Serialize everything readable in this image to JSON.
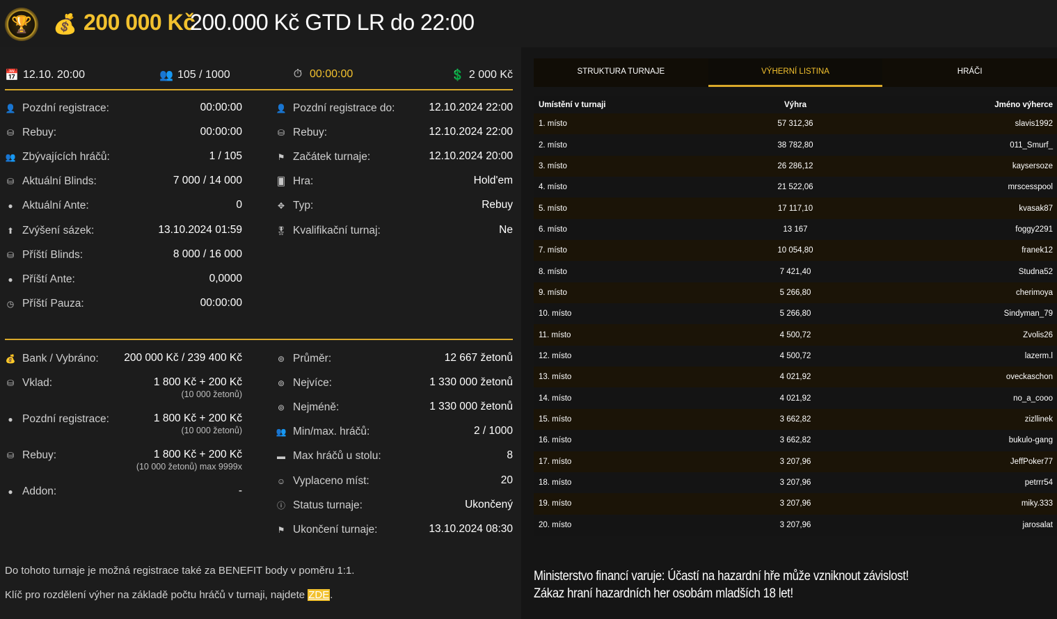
{
  "header": {
    "prize": "200 000 Kč",
    "title": "200.000 Kč GTD LR do 22:00"
  },
  "topbar": {
    "date": "12.10. 20:00",
    "players": "105 / 1000",
    "timer": "00:00:00",
    "buyin": "2 000 Kč"
  },
  "info_left": [
    {
      "icon": "user-icon",
      "label": "Pozdní registrace:",
      "value": "00:00:00"
    },
    {
      "icon": "chips-icon",
      "label": "Rebuy:",
      "value": "00:00:00"
    },
    {
      "icon": "users-icon",
      "label": "Zbývajících hráčů:",
      "value": "1 / 105"
    },
    {
      "icon": "chips-icon",
      "label": "Aktuální Blinds:",
      "value": "7 000 / 14 000"
    },
    {
      "icon": "coin-icon",
      "label": "Aktuální Ante:",
      "value": "0"
    },
    {
      "icon": "arrow-up-icon",
      "label": "Zvýšení sázek:",
      "value": "13.10.2024 01:59"
    },
    {
      "icon": "chips-icon",
      "label": "Příští Blinds:",
      "value": "8 000 / 16 000"
    },
    {
      "icon": "coin-icon",
      "label": "Příští Ante:",
      "value": "0,0000"
    },
    {
      "icon": "clock-icon",
      "label": "Příští Pauza:",
      "value": "00:00:00"
    }
  ],
  "info_right": [
    {
      "icon": "user-icon",
      "label": "Pozdní registrace do:",
      "value": "12.10.2024 22:00"
    },
    {
      "icon": "chips-icon",
      "label": "Rebuy:",
      "value": "12.10.2024 22:00"
    },
    {
      "icon": "flag-icon",
      "label": "Začátek turnaje:",
      "value": "12.10.2024 20:00"
    },
    {
      "icon": "cards-icon",
      "label": "Hra:",
      "value": "Hold'em"
    },
    {
      "icon": "grid-icon",
      "label": "Typ:",
      "value": "Rebuy"
    },
    {
      "icon": "medal-icon",
      "label": "Kvalifikační turnaj:",
      "value": "Ne"
    }
  ],
  "bank_left": [
    {
      "icon": "bag-icon",
      "label": "Bank / Vybráno:",
      "value": "200 000 Kč / 239 400 Kč",
      "sub": ""
    },
    {
      "icon": "chips-icon",
      "label": "Vklad:",
      "value": "1 800 Kč + 200 Kč",
      "sub": "(10 000 žetonů)"
    },
    {
      "icon": "coin-icon",
      "label": "Pozdní registrace:",
      "value": "1 800 Kč + 200 Kč",
      "sub": "(10 000 žetonů)"
    },
    {
      "icon": "chips-icon",
      "label": "Rebuy:",
      "value": "1 800 Kč + 200 Kč",
      "sub": "(10 000 žetonů) max 9999x"
    },
    {
      "icon": "coin-icon",
      "label": "Addon:",
      "value": "-",
      "sub": ""
    }
  ],
  "bank_right": [
    {
      "icon": "chip-icon",
      "label": "Průměr:",
      "value": "12 667 žetonů"
    },
    {
      "icon": "chip-icon",
      "label": "Nejvíce:",
      "value": "1 330 000 žetonů"
    },
    {
      "icon": "chip-icon",
      "label": "Nejméně:",
      "value": "1 330 000 žetonů"
    },
    {
      "icon": "users-icon",
      "label": "Min/max. hráčů:",
      "value": "2 / 1000"
    },
    {
      "icon": "table-icon",
      "label": "Max hráčů u stolu:",
      "value": "8"
    },
    {
      "icon": "payout-icon",
      "label": "Vyplaceno míst:",
      "value": "20"
    },
    {
      "icon": "info-icon",
      "label": "Status turnaje:",
      "value": "Ukončený"
    },
    {
      "icon": "flag-icon",
      "label": "Ukončení turnaje:",
      "value": "13.10.2024 08:30"
    }
  ],
  "notes": {
    "benefit": "Do tohoto turnaje je možná registrace také za BENEFIT body v poměru 1:1.",
    "key_text": "Klíč pro rozdělení výher na základě počtu hráčů v turnaji, najdete ",
    "key_link": "ZDE",
    "key_end": "."
  },
  "tabs": [
    "STRUKTURA TURNAJE",
    "VÝHERNÍ LISTINA",
    "HRÁČI"
  ],
  "table": {
    "headers": [
      "Umístění v turnaji",
      "Výhra",
      "Jméno výherce"
    ],
    "rows": [
      [
        "1. místo",
        "57 312,36",
        "slavis1992"
      ],
      [
        "2. místo",
        "38 782,80",
        "011_Smurf_"
      ],
      [
        "3. místo",
        "26 286,12",
        "kaysersoze"
      ],
      [
        "4. místo",
        "21 522,06",
        "mrscesspool"
      ],
      [
        "5. místo",
        "17 117,10",
        "kvasak87"
      ],
      [
        "6. místo",
        "13 167",
        "foggy2291"
      ],
      [
        "7. místo",
        "10 054,80",
        "franek12"
      ],
      [
        "8. místo",
        "7 421,40",
        "Studna52"
      ],
      [
        "9. místo",
        "5 266,80",
        "cherimoya"
      ],
      [
        "10. místo",
        "5 266,80",
        "Sindyman_79"
      ],
      [
        "11. místo",
        "4 500,72",
        "Zvolis26"
      ],
      [
        "12. místo",
        "4 500,72",
        "lazerm.l"
      ],
      [
        "13. místo",
        "4 021,92",
        "oveckaschon"
      ],
      [
        "14. místo",
        "4 021,92",
        "no_a_cooo"
      ],
      [
        "15. místo",
        "3 662,82",
        "zizllinek"
      ],
      [
        "16. místo",
        "3 662,82",
        "bukulo-gang"
      ],
      [
        "17. místo",
        "3 207,96",
        "JeffPoker77"
      ],
      [
        "18. místo",
        "3 207,96",
        "petrrr54"
      ],
      [
        "19. místo",
        "3 207,96",
        "miky.333"
      ],
      [
        "20. místo",
        "3 207,96",
        "jarosalat"
      ]
    ]
  },
  "warning": {
    "line1": "Ministerstvo financí varuje: Účastí na hazardní hře může vzniknout závislost!",
    "line2": "Zákaz hraní hazardních her osobám mladších 18 let!"
  },
  "colors": {
    "accent": "#f2c12e",
    "background": "#1c1c1c"
  }
}
